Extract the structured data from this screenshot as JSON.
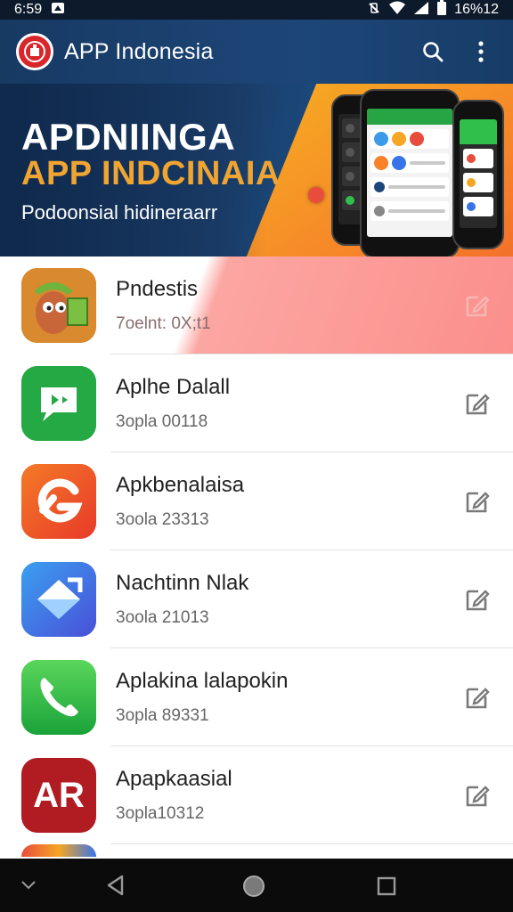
{
  "status_bar": {
    "time": "6:59",
    "battery_text": "16%12"
  },
  "app_bar": {
    "title": "APP Indonesia",
    "logo_icon": "logo-icon",
    "search_icon": "search-icon",
    "menu_icon": "more-vert-icon"
  },
  "banner": {
    "title_line1": "APDNIINGA",
    "title_line2": "APP INDCINAIA",
    "subtitle": "Podoonsial hidineraarr"
  },
  "apps": [
    {
      "name": "Pndestis",
      "meta": "7oelnt: 0X;t1",
      "icon": "cartoon-character-icon",
      "color": "#e8a23b"
    },
    {
      "name": "Aplhe Dalall",
      "meta": "3opla 00118",
      "icon": "chat-bubble-icon",
      "color": "#24a844"
    },
    {
      "name": "Apkbenalaisa",
      "meta": "3oola 23313",
      "icon": "swirl-g-icon",
      "color": "#f15a24"
    },
    {
      "name": "Nachtinn Nlak",
      "meta": "3oola 21013",
      "icon": "arrow-shape-icon",
      "color": "#3874e8"
    },
    {
      "name": "Aplakina lalapokin",
      "meta": "3opla 89331",
      "icon": "phone-icon",
      "color": "#2fbf4a"
    },
    {
      "name": "Apapkaasial",
      "meta": "3opla10312",
      "icon": "ar-text-icon",
      "color": "#b01c22",
      "icon_text": "AR"
    }
  ],
  "colors": {
    "header": "#1d4678",
    "banner_accent": "#f7822a",
    "highlight": "#fb8f8c",
    "nav_bg": "#0b0b0b"
  }
}
